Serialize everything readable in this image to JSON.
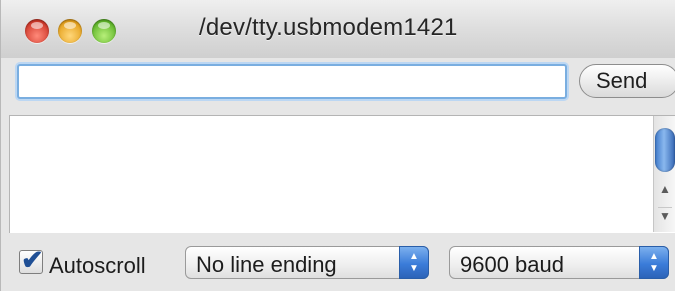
{
  "window": {
    "title": "/dev/tty.usbmodem1421",
    "controls": [
      "close",
      "minimize",
      "zoom"
    ]
  },
  "input": {
    "value": "",
    "placeholder": ""
  },
  "toolbar": {
    "send_label": "Send"
  },
  "output": {
    "text": ""
  },
  "footer": {
    "autoscroll_label": "Autoscroll",
    "autoscroll_checked": true,
    "line_ending_selected": "No line ending",
    "baud_selected": "9600 baud"
  },
  "colors": {
    "accent": "#3b7cd9",
    "focus_ring": "#7aaee0"
  },
  "icons": {
    "stepper_up": "▲",
    "stepper_down": "▼",
    "scroll_up": "▲",
    "scroll_down": "▼",
    "check": "✔"
  }
}
